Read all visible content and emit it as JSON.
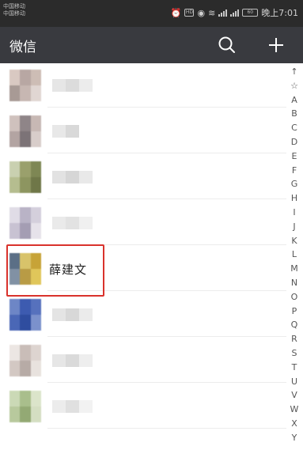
{
  "status_bar": {
    "carrier_1": "中国移动",
    "carrier_2": "中国移动",
    "hd_badge": "HD",
    "battery_label": "60",
    "time": "晚上7:01"
  },
  "app_bar": {
    "title": "微信",
    "search_icon": "search-icon",
    "add_icon": "plus-icon"
  },
  "contacts": [
    {
      "name": ""
    },
    {
      "name": ""
    },
    {
      "name": ""
    },
    {
      "name": ""
    },
    {
      "name": "薛建文"
    },
    {
      "name": ""
    },
    {
      "name": ""
    },
    {
      "name": ""
    }
  ],
  "index_bar": [
    "↑",
    "☆",
    "A",
    "B",
    "C",
    "D",
    "E",
    "F",
    "G",
    "H",
    "I",
    "J",
    "K",
    "L",
    "M",
    "N",
    "O",
    "P",
    "Q",
    "R",
    "S",
    "T",
    "U",
    "V",
    "W",
    "X",
    "Y"
  ],
  "colors": {
    "status_bar_bg": "#2b2b2b",
    "app_bar_bg": "#393a3f",
    "highlight_border": "#d9322c"
  }
}
